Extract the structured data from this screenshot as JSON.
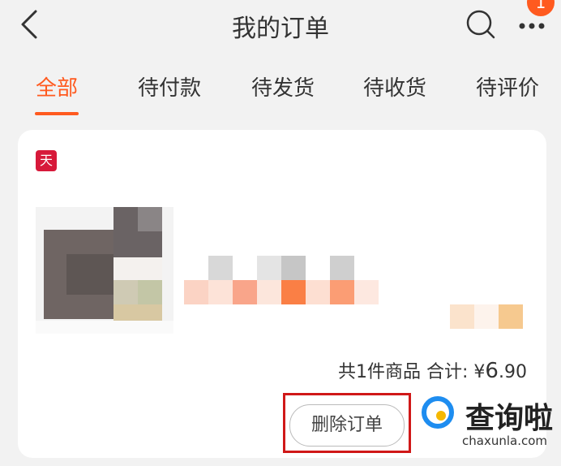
{
  "header": {
    "title": "我的订单",
    "badge_count": "1",
    "icons": [
      "back-icon",
      "search-icon",
      "more-icon"
    ]
  },
  "tabs": [
    {
      "label": "全部",
      "active": true
    },
    {
      "label": "待付款",
      "active": false
    },
    {
      "label": "待发货",
      "active": false
    },
    {
      "label": "待收货",
      "active": false
    },
    {
      "label": "待评价",
      "active": false
    }
  ],
  "order": {
    "shop_logo_text": "天猫",
    "summary_label": "共1件商品 合计:",
    "currency": "¥",
    "amount_int": "6",
    "amount_dec": ".90",
    "delete_label": "删除订单"
  },
  "watermark": {
    "name": "查询啦",
    "domain": "chaxunla.com"
  },
  "colors": {
    "accent": "#ff5a1f",
    "highlight": "#d01818",
    "tmall": "#d7193a"
  }
}
